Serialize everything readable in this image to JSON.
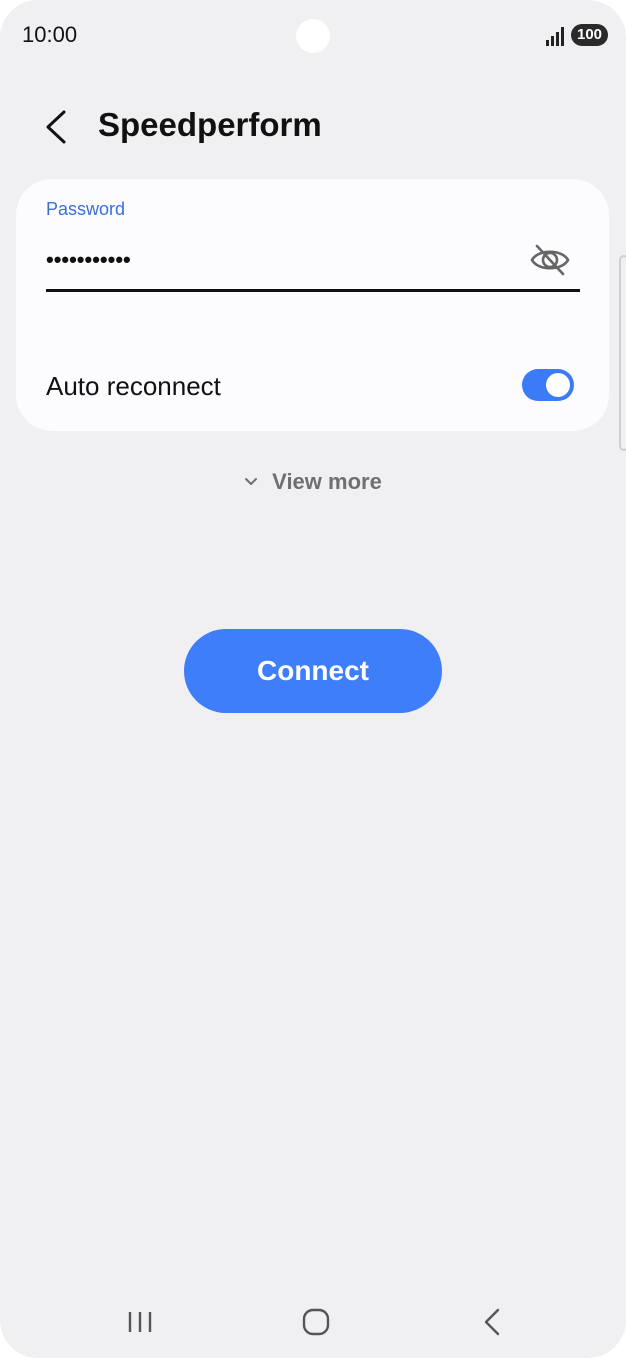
{
  "status_bar": {
    "time": "10:00",
    "battery": "100"
  },
  "header": {
    "title": "Speedperform"
  },
  "form": {
    "password_label": "Password",
    "password_value": "•••••••••••",
    "auto_reconnect_label": "Auto reconnect",
    "auto_reconnect_on": true
  },
  "view_more": {
    "label": "View more"
  },
  "actions": {
    "connect_label": "Connect"
  },
  "colors": {
    "accent": "#3e7ef8",
    "label_blue": "#3a6fd8",
    "background": "#f0f0f3"
  },
  "icons": {
    "back": "chevron-left-icon",
    "password_visibility": "eye-off-icon",
    "view_more": "chevron-down-icon",
    "nav_recents": "recent-apps-icon",
    "nav_home": "home-icon",
    "nav_back": "back-icon"
  }
}
